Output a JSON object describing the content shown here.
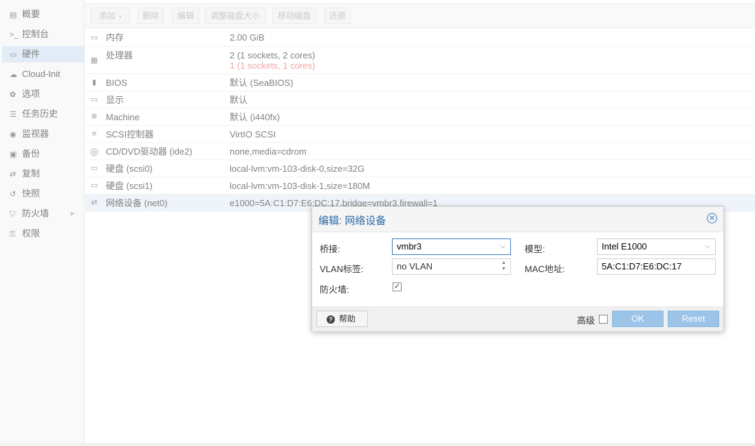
{
  "nav": {
    "items": [
      {
        "label": "概要",
        "icon": "book-icon",
        "glyph": "▤"
      },
      {
        "label": "控制台",
        "icon": "terminal-icon",
        "glyph": ">_"
      },
      {
        "label": "硬件",
        "icon": "desktop-icon",
        "glyph": "▭"
      },
      {
        "label": "Cloud-Init",
        "icon": "cloud-icon",
        "glyph": "☁"
      },
      {
        "label": "选项",
        "icon": "gear-icon",
        "glyph": "✿"
      },
      {
        "label": "任务历史",
        "icon": "list-icon",
        "glyph": "☰"
      },
      {
        "label": "监视器",
        "icon": "eye-icon",
        "glyph": "◉"
      },
      {
        "label": "备份",
        "icon": "floppy-icon",
        "glyph": "▣"
      },
      {
        "label": "复制",
        "icon": "retweet-icon",
        "glyph": "⇄"
      },
      {
        "label": "快照",
        "icon": "history-icon",
        "glyph": "↺"
      },
      {
        "label": "防火墙",
        "icon": "shield-icon",
        "glyph": "⛉"
      },
      {
        "label": "权限",
        "icon": "unlock-icon",
        "glyph": "⚿"
      }
    ],
    "selected_index": 2,
    "firewall_chevron": "▶"
  },
  "toolbar": {
    "add": "添加",
    "add_dropdown": "▾",
    "delete": "删除",
    "edit": "编辑",
    "resize": "调整磁盘大小",
    "move": "移动磁盘",
    "revert": "还原"
  },
  "hardware": [
    {
      "label": "内存",
      "value": "2.00 GiB",
      "icon": "memory-icon",
      "glyph": "▭"
    },
    {
      "label": "处理器",
      "value": "2 (1 sockets, 2 cores)",
      "value2": "1 (1 sockets, 1 cores)",
      "icon": "cpu-icon",
      "glyph": "▦"
    },
    {
      "label": "BIOS",
      "value": "默认 (SeaBIOS)",
      "icon": "microchip-icon",
      "glyph": "▮"
    },
    {
      "label": "显示",
      "value": "默认",
      "icon": "monitor-icon",
      "glyph": "▭"
    },
    {
      "label": "Machine",
      "value": "默认 (i440fx)",
      "icon": "cogs-icon",
      "glyph": "✲"
    },
    {
      "label": "SCSI控制器",
      "value": "VirtIO SCSI",
      "icon": "database-icon",
      "glyph": "≡"
    },
    {
      "label": "CD/DVD驱动器 (ide2)",
      "value": "none,media=cdrom",
      "icon": "cdrom-icon",
      "glyph": "◎"
    },
    {
      "label": "硬盘 (scsi0)",
      "value": "local-lvm:vm-103-disk-0,size=32G",
      "icon": "hdd-icon",
      "glyph": "▭"
    },
    {
      "label": "硬盘 (scsi1)",
      "value": "local-lvm:vm-103-disk-1,size=180M",
      "icon": "hdd-icon",
      "glyph": "▭"
    },
    {
      "label": "网络设备 (net0)",
      "value": "e1000=5A:C1:D7:E6:DC:17,bridge=vmbr3,firewall=1",
      "icon": "exchange-icon",
      "glyph": "⇄"
    }
  ],
  "dialog": {
    "title": "编辑: 网络设备",
    "close_glyph": "✕",
    "bridge_label": "桥接:",
    "bridge_value": "vmbr3",
    "model_label": "模型:",
    "model_value": "Intel E1000",
    "vlan_label": "VLAN标签:",
    "vlan_placeholder": "no VLAN",
    "mac_label": "MAC地址:",
    "mac_value": "5A:C1:D7:E6:DC:17",
    "firewall_label": "防火墙:",
    "firewall_checked": true,
    "check_glyph": "✓",
    "dropdown_glyph": "⌵",
    "spin_up": "▲",
    "spin_down": "▼",
    "help_label": "帮助",
    "help_glyph": "?",
    "advanced_label": "高级",
    "ok_label": "OK",
    "reset_label": "Reset"
  }
}
